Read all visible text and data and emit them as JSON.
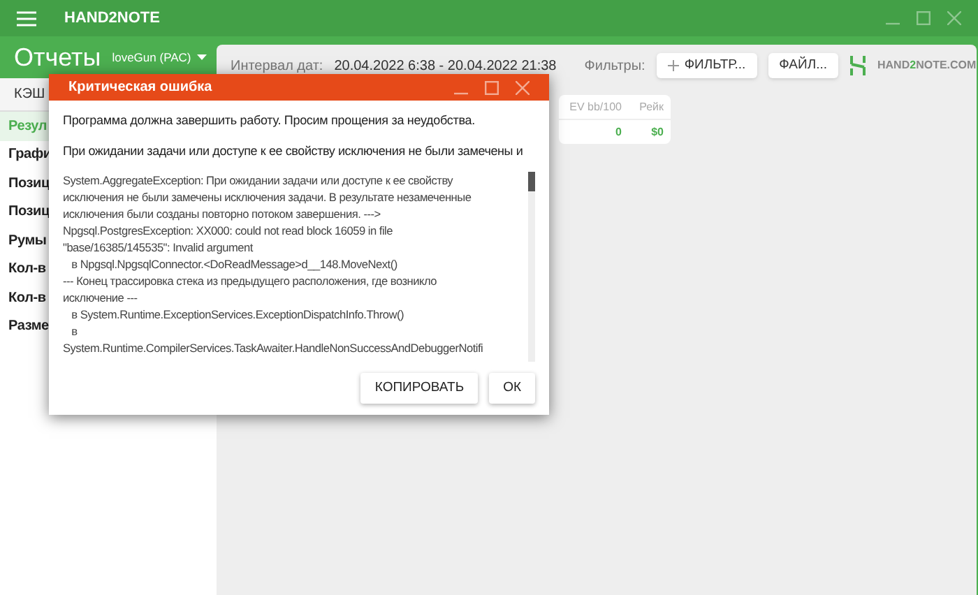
{
  "app_bar": {
    "title": "HAND2NOTE"
  },
  "header": {
    "title": "Отчеты",
    "player": "loveGun (PAC)"
  },
  "toolbar": {
    "interval_label": "Интервал дат:",
    "interval_value": "20.04.2022 6:38 - 20.04.2022 21:38",
    "filters_label": "Фильтры:",
    "buttons": [
      {
        "label": "ФИЛЬТР...",
        "kind": "add"
      },
      {
        "label": "ФАЙЛ...",
        "kind": "plain"
      }
    ],
    "brand": {
      "prefix": "HAND",
      "accent": "2",
      "suffix": "NOTE.COM"
    }
  },
  "sidebar": {
    "header": "КЭШ",
    "items": [
      {
        "label": "Резул",
        "selected": true
      },
      {
        "label": "Графи",
        "selected": false
      },
      {
        "label": "Позиц",
        "selected": false
      },
      {
        "label": "Позиц",
        "selected": false
      },
      {
        "label": "Румы",
        "selected": false
      },
      {
        "label": "Кол-в",
        "selected": false
      },
      {
        "label": "Кол-в",
        "selected": false
      },
      {
        "label": "Разме",
        "selected": false
      }
    ]
  },
  "table": {
    "columns": [
      "EV bb/100",
      "Рейк"
    ],
    "rows": [
      [
        "0",
        "$0"
      ]
    ]
  },
  "dialog": {
    "title": "Критическая ошибка",
    "message": "Программа должна завершить работу. Просим прощения за неудобства.",
    "detail": "При ожидании задачи или доступе к ее свойству исключения не были замечены и",
    "trace_lines": [
      "System.AggregateException: При ожидании задачи или доступе к ее свойству",
      "исключения не были замечены исключения задачи. В результате незамеченные",
      "исключения были созданы повторно потоком завершения. --->",
      "Npgsql.PostgresException: XX000: could not read block 16059 in file",
      "\"base/16385/145535\": Invalid argument",
      "   в Npgsql.NpgsqlConnector.<DoReadMessage>d__148.MoveNext()",
      "--- Конец трассировка стека из предыдущего расположения, где возникло",
      "исключение ---",
      "   в System.Runtime.ExceptionServices.ExceptionDispatchInfo.Throw()",
      "   в",
      "System.Runtime.CompilerServices.TaskAwaiter.HandleNonSuccessAndDebuggerNotifi"
    ],
    "buttons": [
      "КОПИРОВАТЬ",
      "ОК"
    ]
  }
}
